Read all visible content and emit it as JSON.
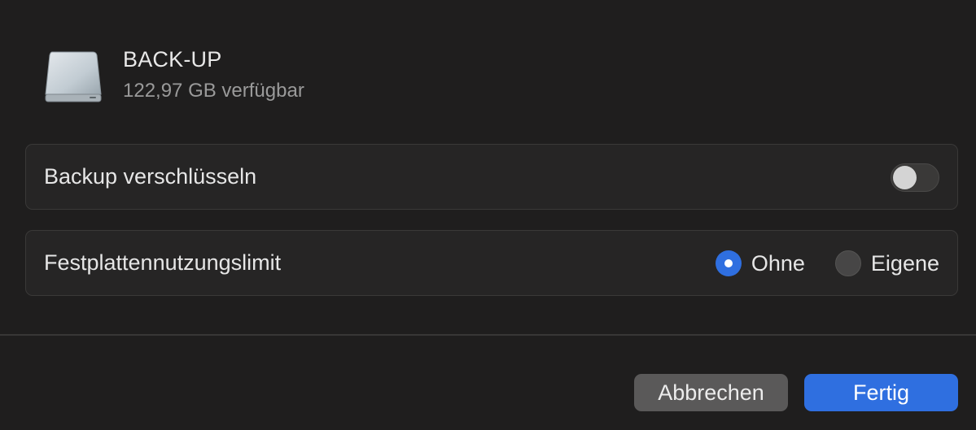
{
  "disk": {
    "icon": "external-drive-icon",
    "name": "BACK-UP",
    "free_space": "122,97 GB verfügbar"
  },
  "encrypt": {
    "label": "Backup verschlüsseln",
    "enabled": false
  },
  "disk_limit": {
    "label": "Festplattennutzungslimit",
    "options": [
      {
        "label": "Ohne",
        "selected": true
      },
      {
        "label": "Eigene",
        "selected": false
      }
    ]
  },
  "buttons": {
    "cancel_label": "Abbrechen",
    "done_label": "Fertig"
  },
  "colors": {
    "accent": "#2f6fe0",
    "background": "#1f1e1e"
  }
}
